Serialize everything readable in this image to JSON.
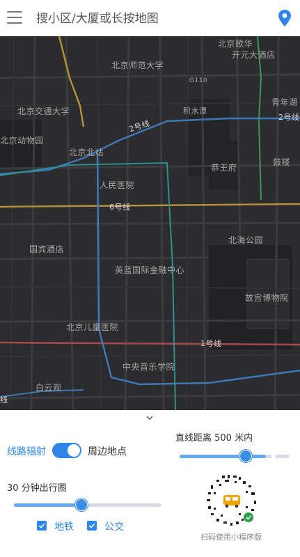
{
  "header": {
    "search_placeholder": "搜小区/大厦或长按地图"
  },
  "map": {
    "labels": [
      {
        "text": "北京歌华"
      },
      {
        "text": "开元大酒店"
      },
      {
        "text": "北京师范大学"
      },
      {
        "text": "G110"
      },
      {
        "text": "北京交通大学"
      },
      {
        "text": "青年湖"
      },
      {
        "text": "积水潭"
      },
      {
        "text": "北京动物园"
      },
      {
        "text": "北京北站"
      },
      {
        "text": "恭王府"
      },
      {
        "text": "鼓楼"
      },
      {
        "text": "人民医院"
      },
      {
        "text": "北海公园"
      },
      {
        "text": "国宾酒店"
      },
      {
        "text": "英蓝国际金融中心"
      },
      {
        "text": "故宫博物院"
      },
      {
        "text": "北京儿童医院"
      },
      {
        "text": "中央音乐学院"
      },
      {
        "text": "白云观"
      }
    ],
    "line_labels": [
      {
        "text": "2号线"
      },
      {
        "text": "2号线"
      },
      {
        "text": "6号线"
      },
      {
        "text": "1号线"
      },
      {
        "text": "线"
      }
    ]
  },
  "panel": {
    "radiate_label": "线路辐射",
    "nearby_label": "周边地点",
    "toggle_on": true,
    "distance_label": "直线距离 500 米内",
    "distance_value": 500,
    "circle_label": "30 分钟出行圈",
    "time_minutes": 30,
    "options": [
      {
        "label": "地铁",
        "checked": true
      },
      {
        "label": "公交",
        "checked": true
      }
    ],
    "qr_caption": "扫码使用小程序版"
  },
  "colors": {
    "accent": "#2f86e8",
    "map_bg": "#2c2c2e",
    "line_2": "#3f78b8",
    "line_6": "#b3903a",
    "line_1": "#a44a4a",
    "line_teal": "#2f8f8f"
  }
}
